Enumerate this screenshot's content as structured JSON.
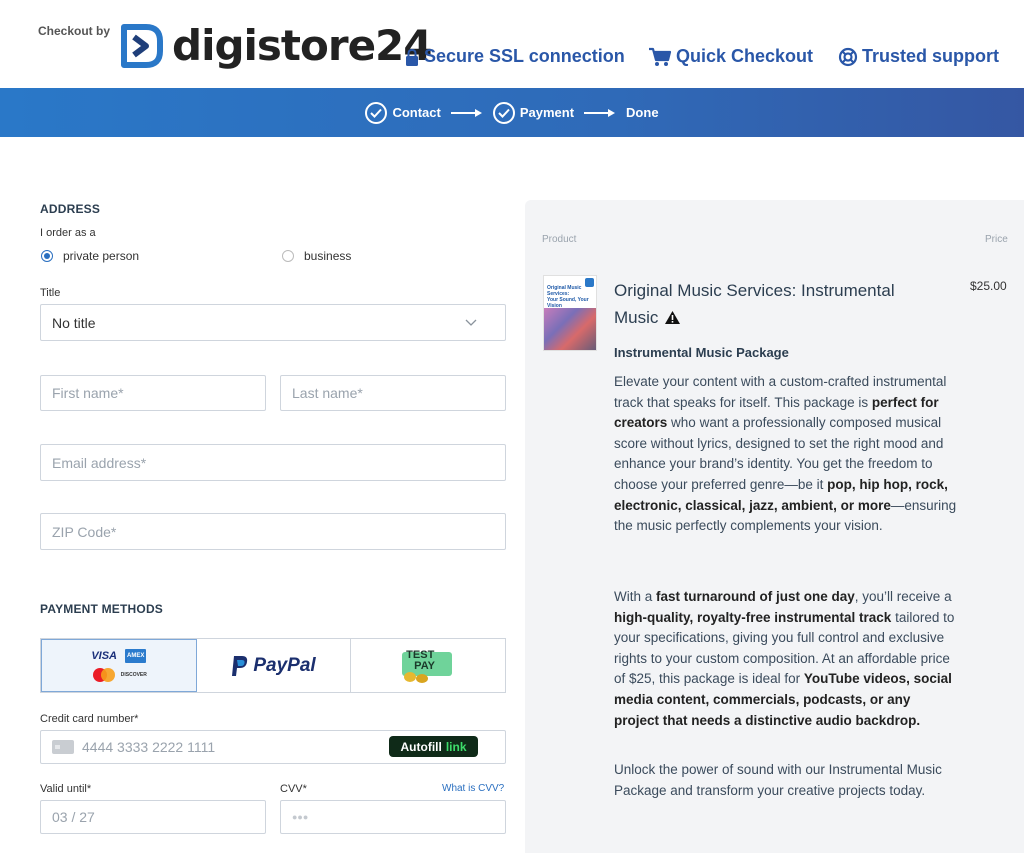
{
  "header": {
    "checkout_by": "Checkout by",
    "logo_text": "digistore24",
    "trust": {
      "ssl": "Secure SSL connection",
      "quick": "Quick Checkout",
      "support": "Trusted support"
    }
  },
  "steps": {
    "contact": "Contact",
    "payment": "Payment",
    "done": "Done"
  },
  "address": {
    "section_title": "ADDRESS",
    "order_as_label": "I order as a",
    "options": [
      "private person",
      "business"
    ],
    "selected": "private person",
    "title_label": "Title",
    "title_value": "No title",
    "first_name_placeholder": "First name*",
    "last_name_placeholder": "Last name*",
    "email_placeholder": "Email address*",
    "zip_placeholder": "ZIP Code*"
  },
  "payment": {
    "section_title": "PAYMENT METHODS",
    "tabs": {
      "card_visa": "VISA",
      "card_amex": "AMEX",
      "card_discover": "DISCOVER",
      "paypal": "PayPal",
      "testpay_top": "TEST",
      "testpay_bottom": "PAY"
    },
    "card_number_label": "Credit card number*",
    "card_number_placeholder": "4444 3333 2222 1111",
    "autofill_label": "Autofill",
    "autofill_link": "link",
    "valid_until_label": "Valid until*",
    "valid_until_placeholder": "03 / 27",
    "cvv_label": "CVV*",
    "cvv_placeholder": "●●●",
    "what_is_cvv": "What is CVV?"
  },
  "summary": {
    "col_product": "Product",
    "col_price": "Price",
    "product_title_line1": "Original Music Services: Instrumental",
    "product_title_line2": "Music",
    "price": "$25.00",
    "thumb_caption_1": "Original Music",
    "thumb_caption_2": "Services:",
    "thumb_caption_3": "Your Sound, Your",
    "thumb_caption_4": "Vision",
    "package_title": "Instrumental Music Package",
    "p1_a": "Elevate your content with a custom-crafted instrumental track that speaks for itself. This package is ",
    "p1_b": "perfect for creators",
    "p1_c": " who want a professionally composed musical score without lyrics, designed to set the right mood and enhance your brand’s identity. You get the freedom to choose your preferred genre—be it ",
    "p1_d": "pop, hip hop, rock, electronic, classical, jazz, ambient, or more",
    "p1_e": "—ensuring the music perfectly complements your vision.",
    "p2_a": "With a ",
    "p2_b": "fast turnaround of just one day",
    "p2_c": ", you’ll receive a ",
    "p2_d": "high-quality, royalty-free instrumental track",
    "p2_e": " tailored to your specifications, giving you full control and exclusive rights to your custom composition. At an affordable price of $25, this package is ideal for ",
    "p2_f": "YouTube videos, social media content, commercials, podcasts, or any project that needs a distinctive audio backdrop.",
    "p3": "Unlock the power of sound with our Instrumental Music Package and transform your creative projects today."
  },
  "colors": {
    "brand_blue": "#2a57a8",
    "steps_bar": "#2f6ab8",
    "panel_bg": "#f3f4f6"
  }
}
